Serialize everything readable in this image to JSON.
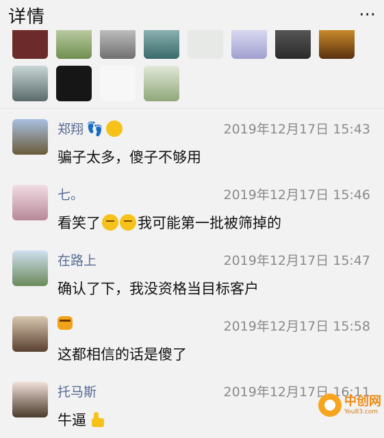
{
  "header": {
    "title": "详情",
    "more": "···"
  },
  "likes": {
    "row1_colors": [
      "#6d2a2a",
      "#7a9a5a",
      "#8d8d8d",
      "#4a7a7a",
      "#dfe3df",
      "#c8c8e8",
      "#3a3a3a",
      "#7a4a1a"
    ],
    "row2_colors": [
      "#5a6a6a",
      "#1a1a1a",
      "#f4f4f4",
      "#9ab08a"
    ]
  },
  "comments": [
    {
      "name": "郑翔",
      "name_emoji": "👣😘",
      "time": "2019年12月17日 15:43",
      "text": "骗子太多，傻子不够用",
      "avatar_color": "#6b5a3a"
    },
    {
      "name": "七。",
      "name_emoji": "",
      "time": "2019年12月17日 15:46",
      "text_before": "看笑了",
      "text_after": "我可能第一批被筛掉的",
      "avatar_color": "#c89aa8"
    },
    {
      "name": "在路上",
      "name_emoji": "",
      "time": "2019年12月17日 15:47",
      "text": "确认了下，我没资格当目标客户",
      "avatar_color": "#6a8a5a"
    },
    {
      "name": "",
      "name_emoji": "tiger",
      "time": "2019年12月17日 15:58",
      "text": "这都相信的话是傻了",
      "avatar_color": "#8a6a4a"
    },
    {
      "name": "托马斯",
      "name_emoji": "",
      "time": "2019年12月17日 16:11",
      "text": "牛逼",
      "avatar_color": "#4a3a2a"
    }
  ],
  "watermark": {
    "main": "中创网",
    "sub": "You83.com"
  }
}
